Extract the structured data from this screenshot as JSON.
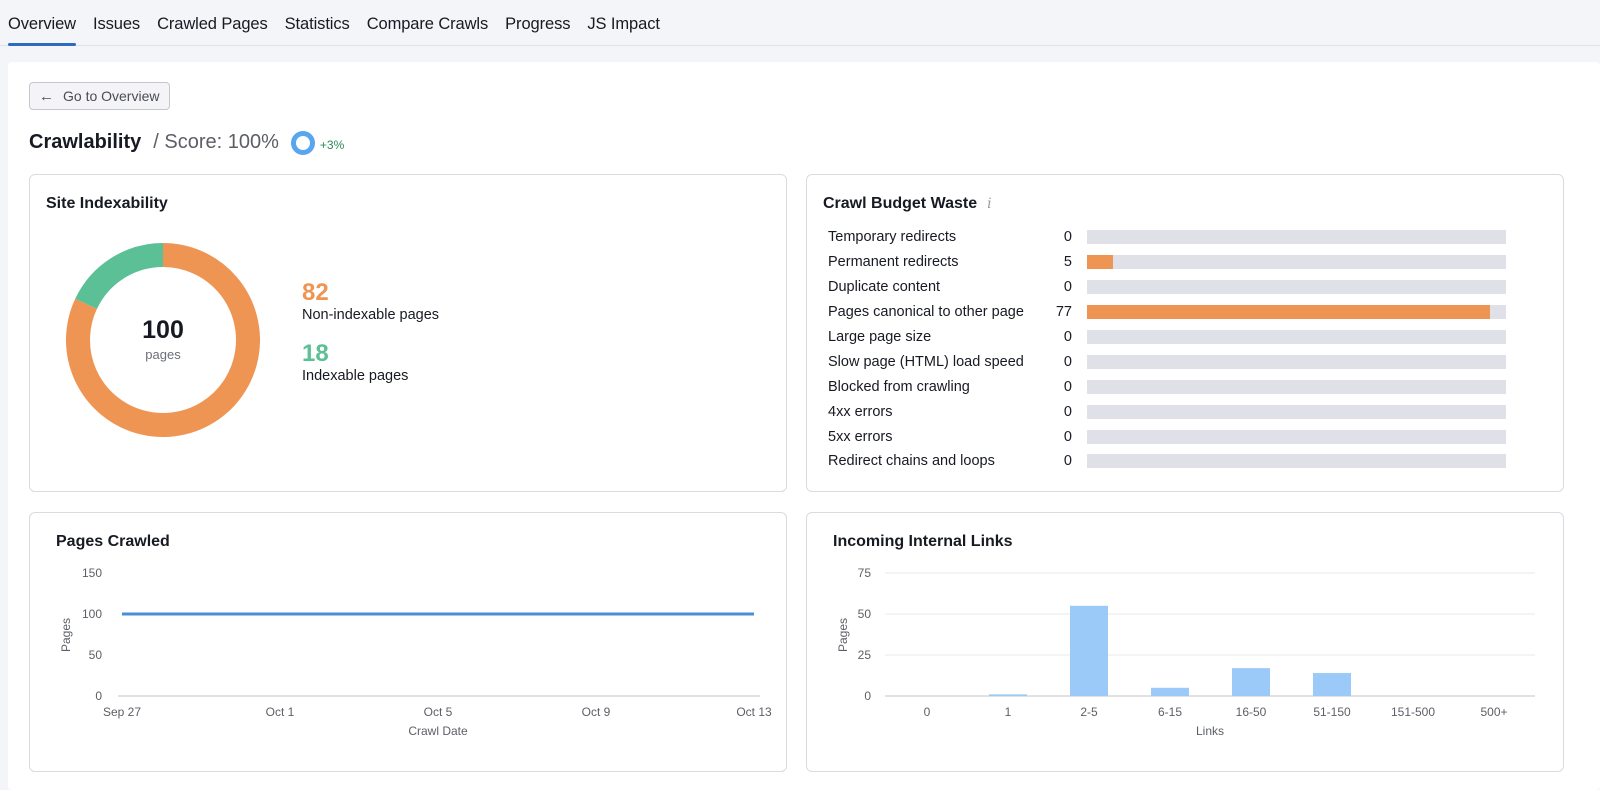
{
  "tabs": [
    {
      "label": "Overview",
      "active": true
    },
    {
      "label": "Issues",
      "active": false
    },
    {
      "label": "Crawled Pages",
      "active": false
    },
    {
      "label": "Statistics",
      "active": false
    },
    {
      "label": "Compare Crawls",
      "active": false
    },
    {
      "label": "Progress",
      "active": false
    },
    {
      "label": "JS Impact",
      "active": false
    }
  ],
  "back_button": {
    "label": "Go to Overview",
    "icon": "arrow-left-icon"
  },
  "header": {
    "title": "Crawlability",
    "score_text": "/ Score: 100%",
    "score_value": 100,
    "delta": "+3%"
  },
  "colors": {
    "accent": "#2e6ac0",
    "orange": "#ef9554",
    "green": "#5bc095",
    "blue_line": "#4a8fd4",
    "blue_bar": "#9ccaf8",
    "track": "#dfe0e8"
  },
  "site_indexability": {
    "title": "Site Indexability",
    "total": "100",
    "total_label": "pages",
    "segments": [
      {
        "label": "Non-indexable pages",
        "value": 82,
        "color": "#ef9554"
      },
      {
        "label": "Indexable pages",
        "value": 18,
        "color": "#5bc095"
      }
    ]
  },
  "crawl_budget": {
    "title": "Crawl Budget Waste",
    "info_icon": "info-icon",
    "max": 80,
    "rows": [
      {
        "label": "Temporary redirects",
        "value": 0
      },
      {
        "label": "Permanent redirects",
        "value": 5
      },
      {
        "label": "Duplicate content",
        "value": 0
      },
      {
        "label": "Pages canonical to other page",
        "value": 77
      },
      {
        "label": "Large page size",
        "value": 0
      },
      {
        "label": "Slow page (HTML) load speed",
        "value": 0
      },
      {
        "label": "Blocked from crawling",
        "value": 0
      },
      {
        "label": "4xx errors",
        "value": 0
      },
      {
        "label": "5xx errors",
        "value": 0
      },
      {
        "label": "Redirect chains and loops",
        "value": 0
      }
    ]
  },
  "chart_data": [
    {
      "type": "line",
      "title": "Pages Crawled",
      "xlabel": "Crawl Date",
      "ylabel": "Pages",
      "x_ticks": [
        "Sep 27",
        "Oct 1",
        "Oct 5",
        "Oct 9",
        "Oct 13"
      ],
      "y_ticks": [
        0,
        50,
        100,
        150
      ],
      "ylim": [
        0,
        150
      ],
      "x_days": [
        0,
        16
      ],
      "series": [
        {
          "name": "Pages",
          "points": [
            {
              "day": 0,
              "value": 100
            },
            {
              "day": 16,
              "value": 100
            }
          ]
        }
      ],
      "grid": true
    },
    {
      "type": "bar",
      "title": "Incoming Internal Links",
      "xlabel": "Links",
      "ylabel": "Pages",
      "categories": [
        "0",
        "1",
        "2-5",
        "6-15",
        "16-50",
        "51-150",
        "151-500",
        "500+"
      ],
      "values": [
        0,
        1,
        55,
        5,
        17,
        14,
        0,
        0
      ],
      "y_ticks": [
        0,
        25,
        50,
        75
      ],
      "ylim": [
        0,
        75
      ],
      "grid": true
    }
  ]
}
